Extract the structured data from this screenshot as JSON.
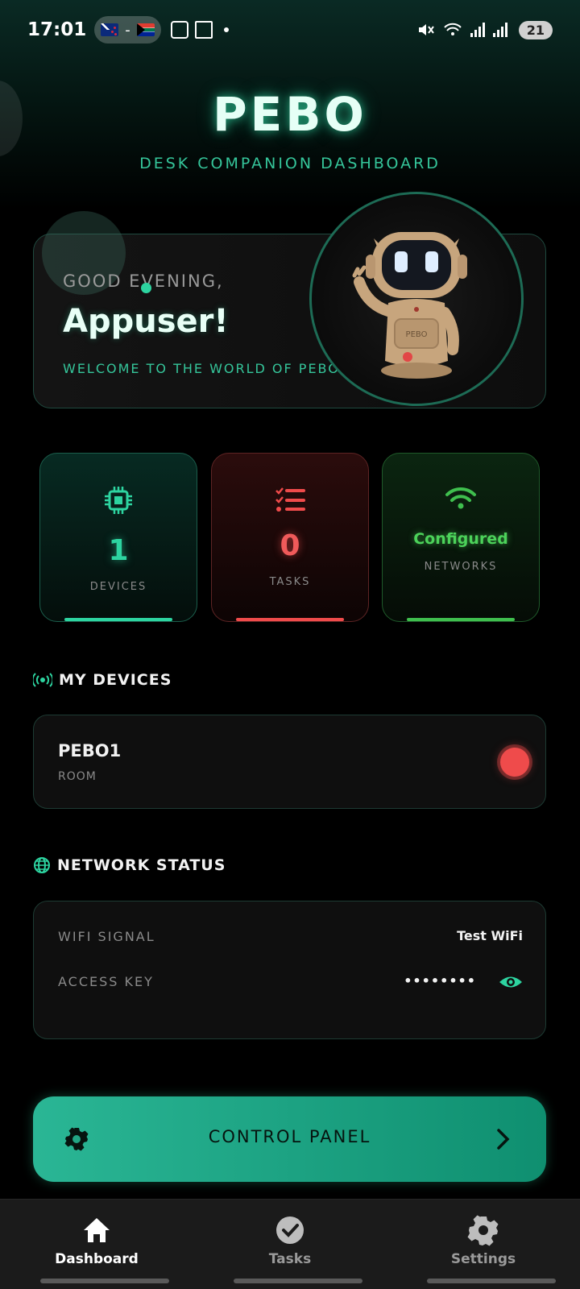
{
  "status_bar": {
    "time": "17:01",
    "separator": "-",
    "battery": "21"
  },
  "header": {
    "brand": "PEBO",
    "subtitle": "DESK COMPANION DASHBOARD"
  },
  "greeting": {
    "salutation": "GOOD EVENING,",
    "name": "Appuser!",
    "welcome": "WELCOME TO THE WORLD OF PEBO",
    "robot_chest_label": "PEBO"
  },
  "stats": {
    "devices": {
      "value": "1",
      "label": "DEVICES",
      "icon": "chip-icon"
    },
    "tasks": {
      "value": "0",
      "label": "TASKS",
      "icon": "checklist-icon"
    },
    "networks": {
      "value": "Configured",
      "label": "NETWORKS",
      "icon": "wifi-icon"
    }
  },
  "my_devices": {
    "title": "MY DEVICES",
    "icon": "broadcast-icon",
    "items": [
      {
        "name": "PEBO1",
        "room": "ROOM",
        "status_color": "#ef4b4b"
      }
    ]
  },
  "network_status": {
    "title": "NETWORK STATUS",
    "icon": "globe-icon",
    "wifi_label": "WIFI SIGNAL",
    "wifi_value": "Test WiFi",
    "key_label": "ACCESS KEY",
    "key_value": "••••••••"
  },
  "control_panel": {
    "label": "CONTROL PANEL",
    "icon": "gear-icon"
  },
  "bottom_nav": {
    "items": [
      {
        "label": "Dashboard",
        "icon": "home-icon",
        "active": true
      },
      {
        "label": "Tasks",
        "icon": "check-circle-icon",
        "active": false
      },
      {
        "label": "Settings",
        "icon": "gear-icon",
        "active": false
      }
    ]
  },
  "colors": {
    "accent": "#2dd4a0",
    "danger": "#ef4b4b",
    "success": "#4cd25a",
    "background": "#000000"
  }
}
